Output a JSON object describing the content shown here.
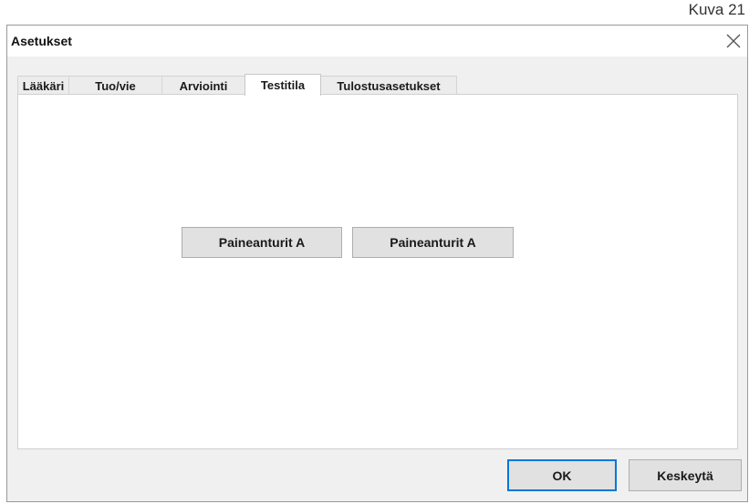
{
  "figure_caption": "Kuva 21",
  "dialog": {
    "title": "Asetukset",
    "close_icon": "close-x-icon",
    "tabs": [
      {
        "label": "Lääkäri"
      },
      {
        "label": "Tuo/vie"
      },
      {
        "label": "Arviointi"
      },
      {
        "label": "Testitila"
      },
      {
        "label": "Tulostusasetukset"
      }
    ],
    "active_tab": "Testitila",
    "panel": {
      "buttons": [
        {
          "label": "Paineanturit A"
        },
        {
          "label": "Paineanturit A"
        }
      ]
    },
    "footer": {
      "ok_label": "OK",
      "cancel_label": "Keskeytä"
    }
  },
  "colors": {
    "dialog_background": "#f0f0f0",
    "button_face": "#e1e1e1",
    "default_button_border": "#0078d7"
  }
}
